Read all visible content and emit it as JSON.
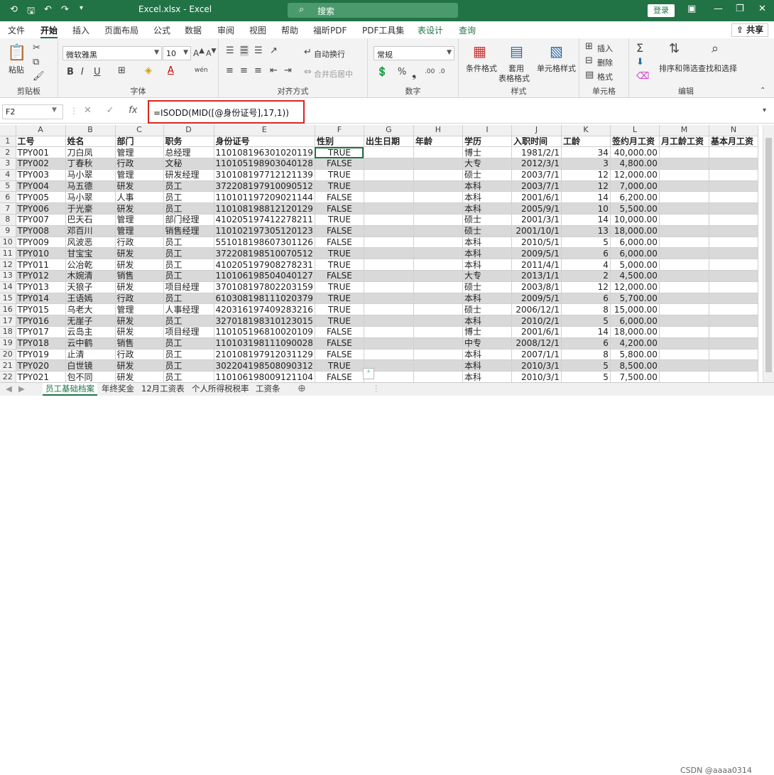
{
  "titlebar": {
    "file_title": "Excel.xlsx  -  Excel",
    "search": "搜索",
    "login": "登录"
  },
  "tabs": [
    "文件",
    "开始",
    "插入",
    "页面布局",
    "公式",
    "数据",
    "审阅",
    "视图",
    "帮助",
    "福昕PDF",
    "PDF工具集",
    "表设计",
    "查询"
  ],
  "share": "共享",
  "ribbon": {
    "clipboard": {
      "paste": "粘贴",
      "label": "剪贴板"
    },
    "font": {
      "name": "微软雅黑",
      "size": "10",
      "label": "字体"
    },
    "align": {
      "wrap": "自动换行",
      "merge": "合并后居中",
      "label": "对齐方式"
    },
    "number": {
      "format": "常规",
      "label": "数字"
    },
    "styles": {
      "cond": "条件格式",
      "table1": "套用",
      "table2": "表格格式",
      "cell": "单元格样式",
      "label": "样式"
    },
    "cells": {
      "insert": "插入",
      "delete": "删除",
      "format": "格式",
      "label": "单元格"
    },
    "editing": {
      "sort": "排序和筛选",
      "find": "查找和选择",
      "label": "编辑"
    }
  },
  "formula_bar": {
    "name_box": "F2",
    "formula": "=ISODD(MID([@身份证号],17,1))"
  },
  "columns": [
    "A",
    "B",
    "C",
    "D",
    "E",
    "F",
    "G",
    "H",
    "I",
    "J",
    "K",
    "L",
    "M",
    "N"
  ],
  "headers": [
    "工号",
    "姓名",
    "部门",
    "职务",
    "身份证号",
    "性别",
    "出生日期",
    "年龄",
    "学历",
    "入职时间",
    "工龄",
    "签约月工资",
    "月工龄工资",
    "基本月工资"
  ],
  "rows": [
    [
      "TPY001",
      "刀白凤",
      "管理",
      "总经理",
      "110108196301020119",
      "TRUE",
      "",
      "",
      "博士",
      "1981/2/1",
      "34",
      "40,000.00"
    ],
    [
      "TPY002",
      "丁春秋",
      "行政",
      "文秘",
      "110105198903040128",
      "FALSE",
      "",
      "",
      "大专",
      "2012/3/1",
      "3",
      "4,800.00"
    ],
    [
      "TPY003",
      "马小翠",
      "管理",
      "研发经理",
      "310108197712121139",
      "TRUE",
      "",
      "",
      "硕士",
      "2003/7/1",
      "12",
      "12,000.00"
    ],
    [
      "TPY004",
      "马五德",
      "研发",
      "员工",
      "372208197910090512",
      "TRUE",
      "",
      "",
      "本科",
      "2003/7/1",
      "12",
      "7,000.00"
    ],
    [
      "TPY005",
      "马小翠",
      "人事",
      "员工",
      "110101197209021144",
      "FALSE",
      "",
      "",
      "本科",
      "2001/6/1",
      "14",
      "6,200.00"
    ],
    [
      "TPY006",
      "于光豪",
      "研发",
      "员工",
      "110108198812120129",
      "FALSE",
      "",
      "",
      "本科",
      "2005/9/1",
      "10",
      "5,500.00"
    ],
    [
      "TPY007",
      "巴天石",
      "管理",
      "部门经理",
      "410205197412278211",
      "TRUE",
      "",
      "",
      "硕士",
      "2001/3/1",
      "14",
      "10,000.00"
    ],
    [
      "TPY008",
      "邓百川",
      "管理",
      "销售经理",
      "110102197305120123",
      "FALSE",
      "",
      "",
      "硕士",
      "2001/10/1",
      "13",
      "18,000.00"
    ],
    [
      "TPY009",
      "风波恶",
      "行政",
      "员工",
      "551018198607301126",
      "FALSE",
      "",
      "",
      "本科",
      "2010/5/1",
      "5",
      "6,000.00"
    ],
    [
      "TPY010",
      "甘宝宝",
      "研发",
      "员工",
      "372208198510070512",
      "TRUE",
      "",
      "",
      "本科",
      "2009/5/1",
      "6",
      "6,000.00"
    ],
    [
      "TPY011",
      "公冶乾",
      "研发",
      "员工",
      "410205197908278231",
      "TRUE",
      "",
      "",
      "本科",
      "2011/4/1",
      "4",
      "5,000.00"
    ],
    [
      "TPY012",
      "木婉清",
      "销售",
      "员工",
      "110106198504040127",
      "FALSE",
      "",
      "",
      "大专",
      "2013/1/1",
      "2",
      "4,500.00"
    ],
    [
      "TPY013",
      "天狼子",
      "研发",
      "项目经理",
      "370108197802203159",
      "TRUE",
      "",
      "",
      "硕士",
      "2003/8/1",
      "12",
      "12,000.00"
    ],
    [
      "TPY014",
      "王语嫣",
      "行政",
      "员工",
      "610308198111020379",
      "TRUE",
      "",
      "",
      "本科",
      "2009/5/1",
      "6",
      "5,700.00"
    ],
    [
      "TPY015",
      "乌老大",
      "管理",
      "人事经理",
      "420316197409283216",
      "TRUE",
      "",
      "",
      "硕士",
      "2006/12/1",
      "8",
      "15,000.00"
    ],
    [
      "TPY016",
      "无崖子",
      "研发",
      "员工",
      "327018198310123015",
      "TRUE",
      "",
      "",
      "本科",
      "2010/2/1",
      "5",
      "6,000.00"
    ],
    [
      "TPY017",
      "云岛主",
      "研发",
      "项目经理",
      "110105196810020109",
      "FALSE",
      "",
      "",
      "博士",
      "2001/6/1",
      "14",
      "18,000.00"
    ],
    [
      "TPY018",
      "云中鹤",
      "销售",
      "员工",
      "110103198111090028",
      "FALSE",
      "",
      "",
      "中专",
      "2008/12/1",
      "6",
      "4,200.00"
    ],
    [
      "TPY019",
      "止清",
      "行政",
      "员工",
      "210108197912031129",
      "FALSE",
      "",
      "",
      "本科",
      "2007/1/1",
      "8",
      "5,800.00"
    ],
    [
      "TPY020",
      "白世镜",
      "研发",
      "员工",
      "302204198508090312",
      "TRUE",
      "",
      "",
      "本科",
      "2010/3/1",
      "5",
      "8,500.00"
    ],
    [
      "TPY021",
      "包不同",
      "研发",
      "员工",
      "110106198009121104",
      "FALSE",
      "",
      "",
      "本科",
      "2010/3/1",
      "5",
      "7,500.00"
    ]
  ],
  "sheet_tabs": [
    "员工基础档案",
    "年终奖金",
    "12月工资表",
    "个人所得税税率",
    "工资条"
  ],
  "watermark": "CSDN @aaaa0314"
}
